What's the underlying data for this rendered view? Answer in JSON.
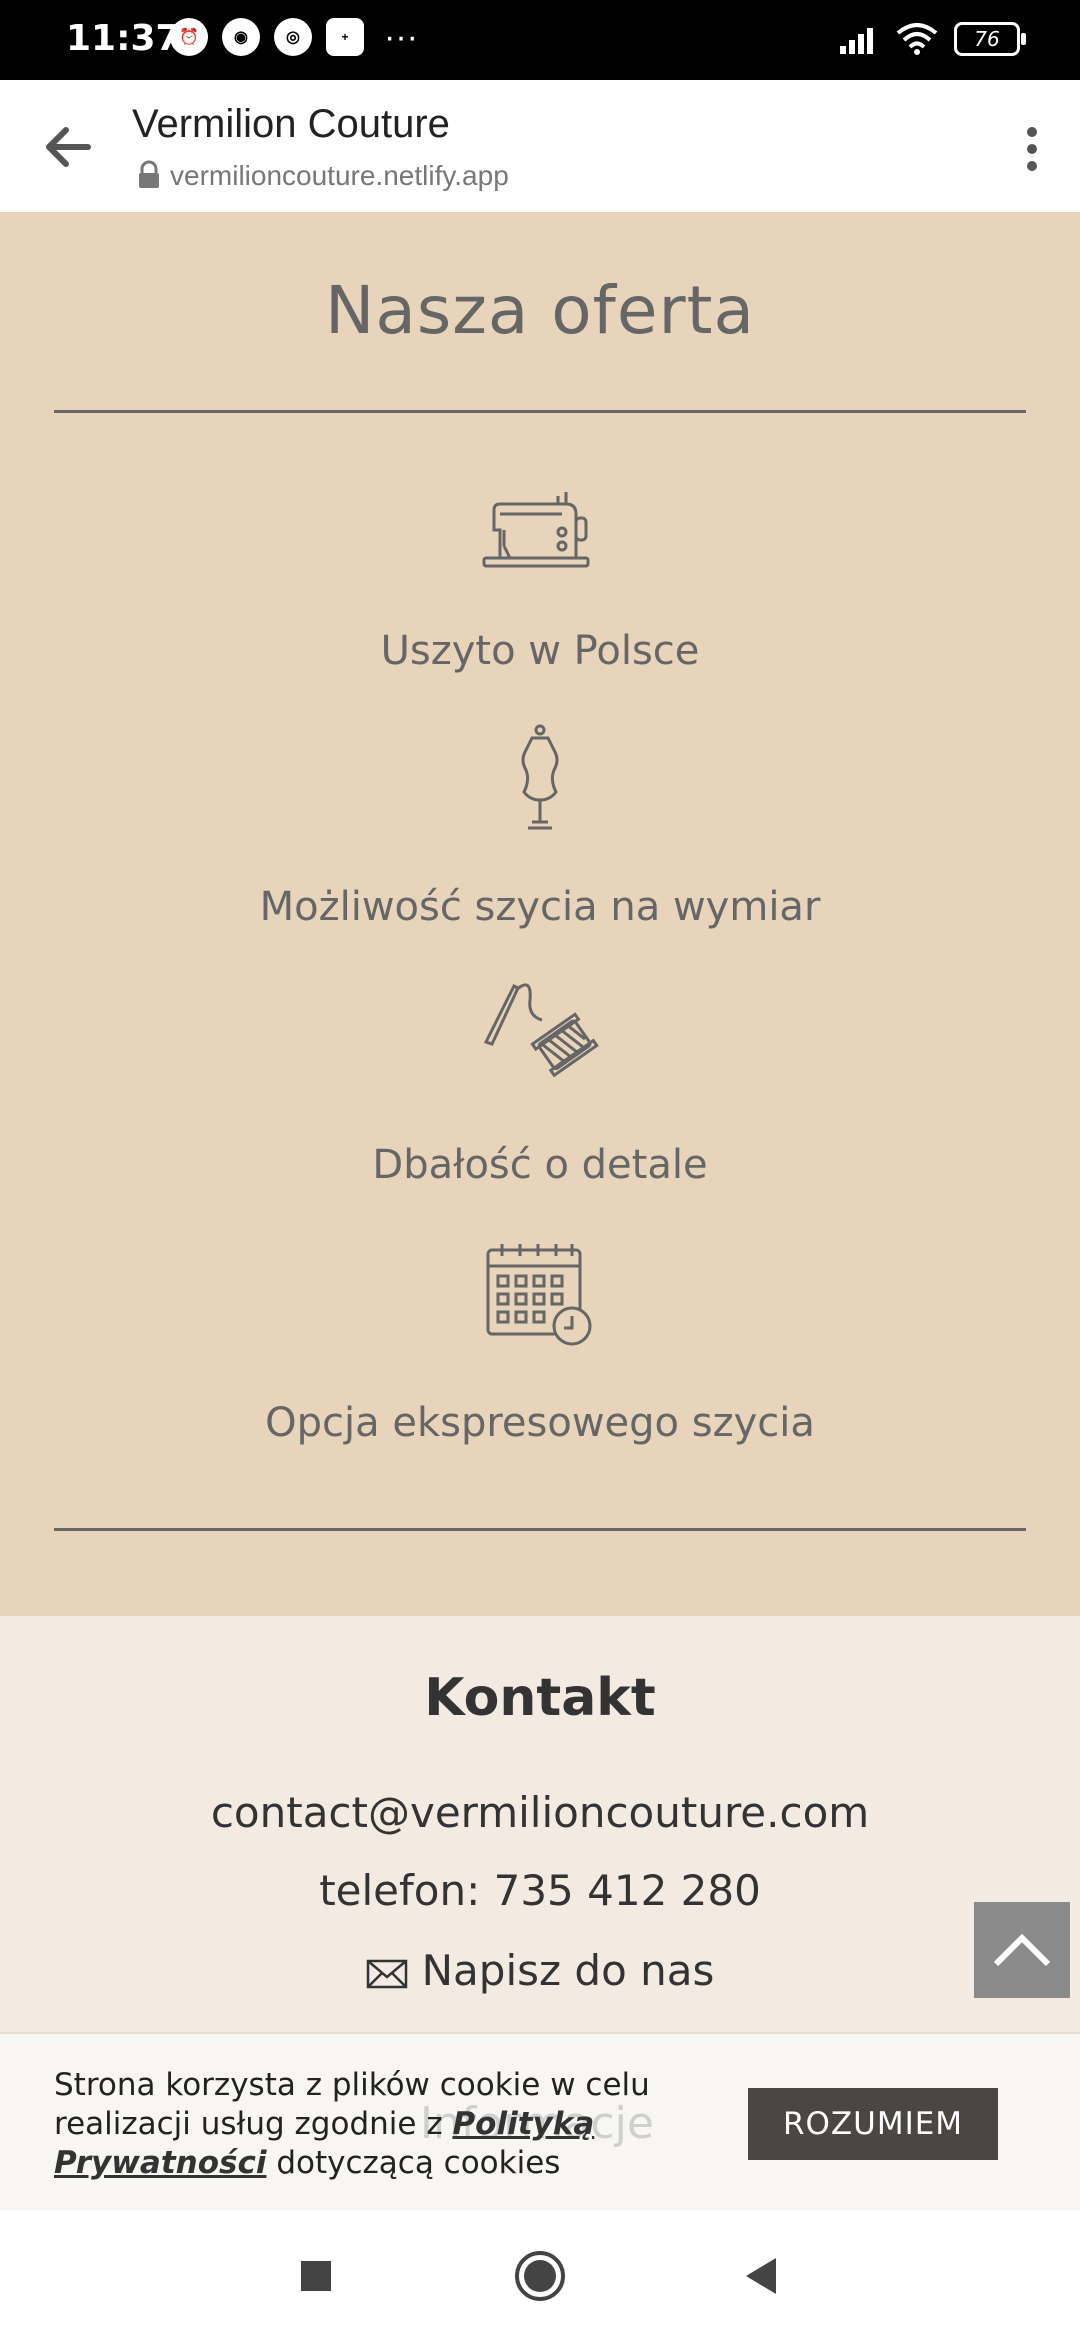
{
  "status_bar": {
    "time": "11:37",
    "battery": "76",
    "more": "···"
  },
  "browser": {
    "title": "Vermilion Couture",
    "url": "vermilioncouture.netlify.app"
  },
  "offer": {
    "heading": "Nasza oferta",
    "features": [
      {
        "icon": "sewing-machine-icon",
        "label": "Uszyto w Polsce"
      },
      {
        "icon": "dress-form-icon",
        "label": "Możliwość szycia na wymiar"
      },
      {
        "icon": "needle-thread-icon",
        "label": "Dbałość o detale"
      },
      {
        "icon": "calendar-clock-icon",
        "label": "Opcja ekspresowego szycia"
      }
    ]
  },
  "contact": {
    "heading": "Kontakt",
    "email": "contact@vermilioncouture.com",
    "phone": "telefon: 735 412 280",
    "write_us": "Napisz do nas"
  },
  "cookie": {
    "text_before": "Strona korzysta z plików cookie w celu realizacji usług zgodnie z ",
    "link": "Polityką Prywatności",
    "text_after": " dotyczącą cookies",
    "button": "ROZUMIEM",
    "hidden_heading": "Informacje"
  },
  "colors": {
    "offer_bg": "#e7d4bb",
    "contact_bg": "#f3ebe2",
    "button_bg": "#4a4743"
  }
}
